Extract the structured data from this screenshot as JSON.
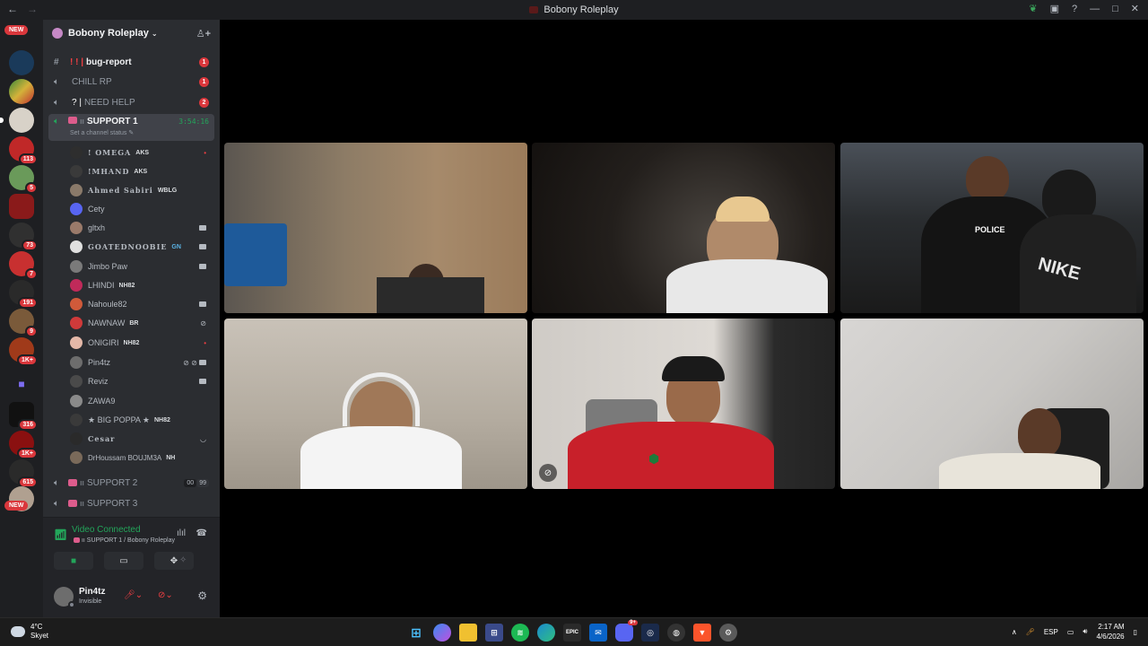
{
  "window": {
    "title": "Bobony Roleplay"
  },
  "guild_bar": {
    "new_label_top": "NEW",
    "new_label_bottom": "NEW",
    "badges": [
      "113",
      "5",
      "73",
      "7",
      "191",
      "9",
      "1K+",
      "316",
      "1K+",
      "615"
    ]
  },
  "server": {
    "name": "Bobony Roleplay"
  },
  "channels": [
    {
      "name": "bug-report",
      "prefix": "! ! |",
      "count": "1"
    },
    {
      "name": "CHILL RP",
      "count": "1"
    },
    {
      "name": "NEED HELP",
      "prefix": "? |",
      "count": "2"
    },
    {
      "name": "SUPPORT 1",
      "timer": "3:54:16",
      "status": "Set a channel status"
    }
  ],
  "members": [
    {
      "name": "! OMEGA",
      "tag": "AKS"
    },
    {
      "name": "!MHAND",
      "tag": "AKS"
    },
    {
      "name": "Ahmed Sabiri",
      "tag": "WBLG"
    },
    {
      "name": "Cety"
    },
    {
      "name": "gltxh"
    },
    {
      "name": "GOATEDNOOBIE",
      "tag": "GN"
    },
    {
      "name": "Jimbo Paw"
    },
    {
      "name": "LHINDI",
      "tag": "NH82"
    },
    {
      "name": "Nahoule82"
    },
    {
      "name": "NAWNAW",
      "tag": "BR"
    },
    {
      "name": "ONIGIRI",
      "tag": "NH82"
    },
    {
      "name": "Pin4tz"
    },
    {
      "name": "Reviz"
    },
    {
      "name": "ZAWA9"
    },
    {
      "name": "★ BIG POPPA ★",
      "tag": "NH82"
    },
    {
      "name": "Cesar"
    },
    {
      "name": "DrHoussam BOUJM3A",
      "tag": "NH"
    }
  ],
  "channels_after": [
    {
      "name": "SUPPORT 2",
      "counts": [
        "00",
        "99"
      ]
    },
    {
      "name": "SUPPORT 3"
    }
  ],
  "voice": {
    "status": "Video Connected",
    "location": "SUPPORT 1 / Bobony Roleplay"
  },
  "user": {
    "name": "Pin4tz",
    "status": "Invisible"
  },
  "video_overlays": {
    "tile5_text": "POLICE",
    "tile3_shirt_text": "NIKE"
  },
  "taskbar": {
    "weather_temp": "4°C",
    "weather_desc": "Skyet",
    "lang": "ESP",
    "time": "2:17 AM",
    "date": "4/6/2026",
    "discord_badge": "9+"
  },
  "colors": {
    "online_green": "#23a55a",
    "badge_red": "#da373c",
    "bg_sidebar": "#2b2d31"
  }
}
